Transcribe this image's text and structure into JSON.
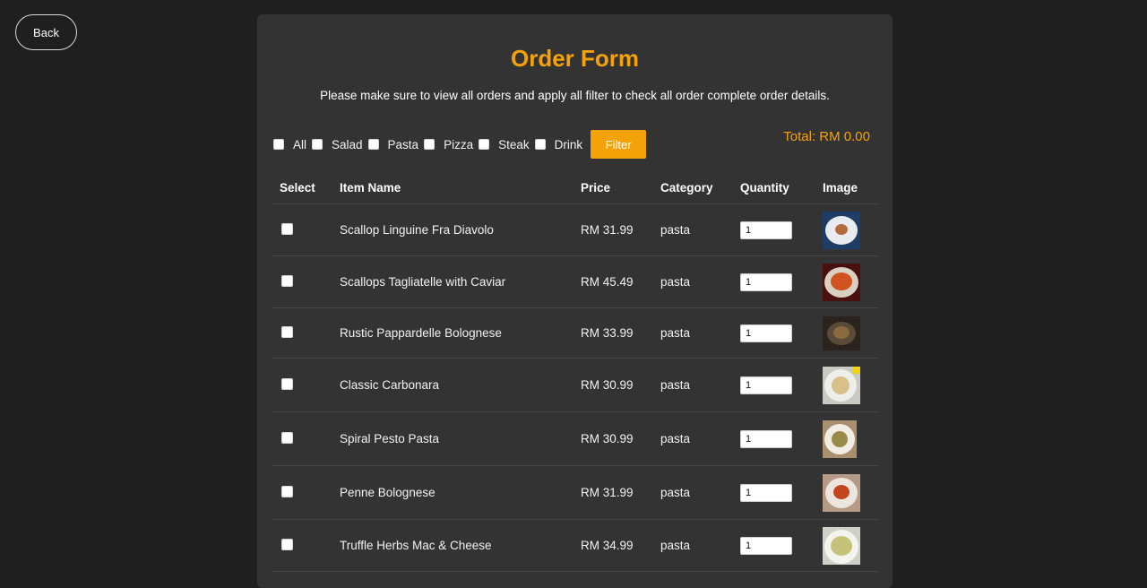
{
  "back_label": "Back",
  "title": "Order Form",
  "subtitle": "Please make sure to view all orders and apply all filter to check all order complete order details.",
  "filters": [
    "All",
    "Salad",
    "Pasta",
    "Pizza",
    "Steak",
    "Drink"
  ],
  "filter_button": "Filter",
  "total": "Total: RM 0.00",
  "headers": {
    "select": "Select",
    "name": "Item Name",
    "price": "Price",
    "category": "Category",
    "quantity": "Quantity",
    "image": "Image"
  },
  "items": [
    {
      "name": "Scallop Linguine Fra Diavolo",
      "price": "RM 31.99",
      "category": "pasta",
      "quantity": "1"
    },
    {
      "name": "Scallops Tagliatelle with Caviar",
      "price": "RM 45.49",
      "category": "pasta",
      "quantity": "1"
    },
    {
      "name": "Rustic Pappardelle Bolognese",
      "price": "RM 33.99",
      "category": "pasta",
      "quantity": "1"
    },
    {
      "name": "Classic Carbonara",
      "price": "RM 30.99",
      "category": "pasta",
      "quantity": "1"
    },
    {
      "name": "Spiral Pesto Pasta",
      "price": "RM 30.99",
      "category": "pasta",
      "quantity": "1"
    },
    {
      "name": "Penne Bolognese",
      "price": "RM 31.99",
      "category": "pasta",
      "quantity": "1"
    },
    {
      "name": "Truffle Herbs Mac & Cheese",
      "price": "RM 34.99",
      "category": "pasta",
      "quantity": "1"
    }
  ],
  "colors": {
    "accent": "#f5a209",
    "background": "#1f1f1f",
    "panel": "#333333"
  }
}
